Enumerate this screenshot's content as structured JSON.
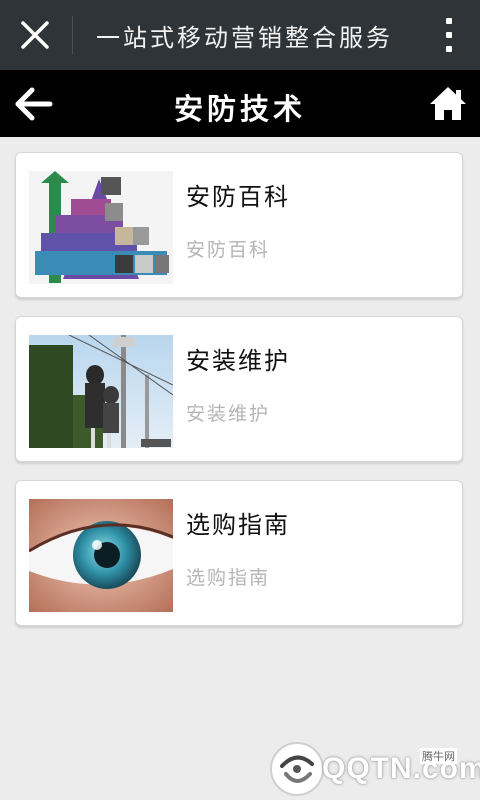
{
  "topbar": {
    "title": "一站式移动营销整合服务",
    "close_icon": "close-icon",
    "more_icon": "more-vertical-icon"
  },
  "header": {
    "title": "安防技术",
    "back_icon": "back-arrow-icon",
    "home_icon": "home-icon"
  },
  "cards": [
    {
      "title": "安防百科",
      "subtitle": "安防百科",
      "image": "security-pyramid-chart-image"
    },
    {
      "title": "安装维护",
      "subtitle": "安装维护",
      "image": "workers-installing-camera-image"
    },
    {
      "title": "选购指南",
      "subtitle": "选购指南",
      "image": "eye-closeup-image"
    }
  ],
  "watermark": {
    "brand": "QQTN.com",
    "site": "腾牛网"
  },
  "colors": {
    "topbar_bg": "#2f3438",
    "header_bg": "#000000",
    "page_bg": "#ececec",
    "card_bg": "#ffffff",
    "subtitle": "#b5b5b5"
  }
}
